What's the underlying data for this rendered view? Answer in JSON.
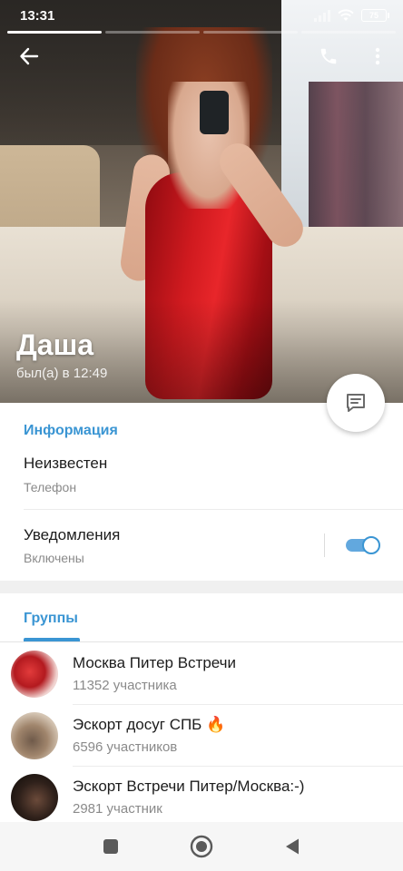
{
  "status_bar": {
    "time": "13:31",
    "battery": "75"
  },
  "story": {
    "segments": 4,
    "active_index": 0
  },
  "profile": {
    "name": "Даша",
    "last_seen": "был(а) в 12:49"
  },
  "info": {
    "section_title": "Информация",
    "phone_value": "Неизвестен",
    "phone_label": "Телефон",
    "notifications_label": "Уведомления",
    "notifications_status": "Включены",
    "notifications_on": true
  },
  "tabs": {
    "groups_label": "Группы"
  },
  "groups": [
    {
      "title": "Москва Питер Встречи",
      "subtitle": "11352 участника"
    },
    {
      "title": "Эскорт досуг СПБ 🔥",
      "subtitle": "6596 участников"
    },
    {
      "title": "Эскорт Встречи Питер/Москва:-)",
      "subtitle": "2981 участник"
    }
  ],
  "icons": {
    "back": "arrow-left-icon",
    "call": "phone-icon",
    "more": "more-vertical-icon",
    "message": "message-icon"
  },
  "colors": {
    "accent": "#3a95d3",
    "toggle_track": "#62a8de"
  }
}
